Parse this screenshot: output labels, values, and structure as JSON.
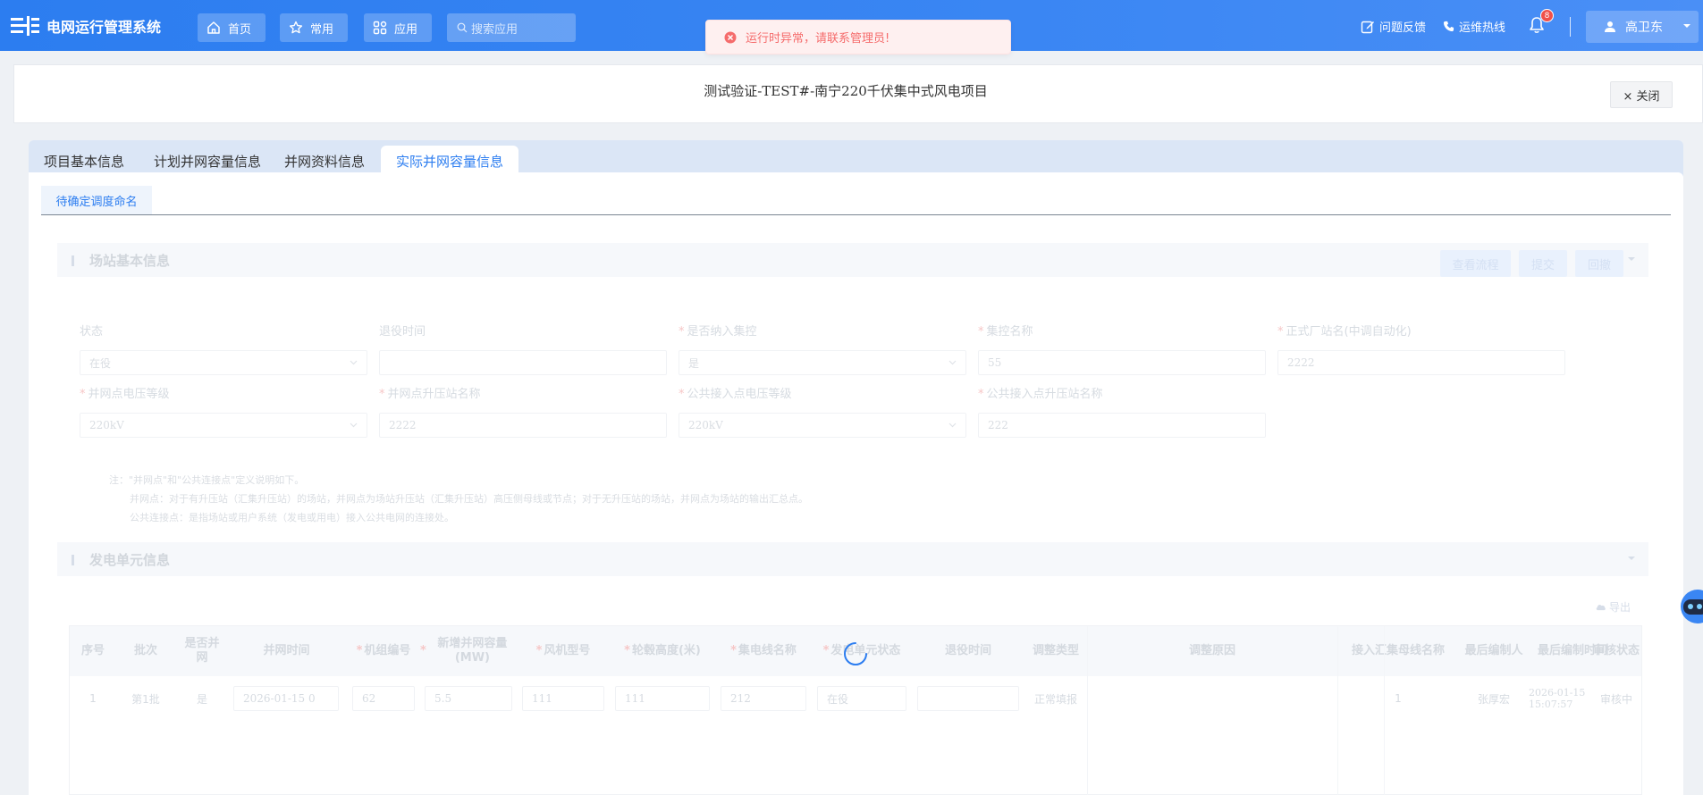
{
  "header": {
    "app_title": "电网运行管理系统",
    "nav": {
      "home": "首页",
      "common": "常用",
      "apps": "应用"
    },
    "search_placeholder": "搜索应用",
    "feedback": "问题反馈",
    "hotline": "运维热线",
    "notification_count": "8",
    "user_name": "高卫东"
  },
  "toast": {
    "message": "运行时异常，请联系管理员!",
    "color": "#f56c6c"
  },
  "page": {
    "title": "测试验证-TEST#-南宁220千伏集中式风电项目",
    "close_label": "× 关闭"
  },
  "tabs": [
    {
      "label": "项目基本信息",
      "active": false
    },
    {
      "label": "计划并网容量信息",
      "active": false
    },
    {
      "label": "并网资料信息",
      "active": false
    },
    {
      "label": "实际并网容量信息",
      "active": true
    }
  ],
  "subtab": {
    "label": "待确定调度命名"
  },
  "station_section": {
    "title": "场站基本信息",
    "buttons": {
      "review_flow": "查看流程",
      "submit": "提交",
      "revoke": "回撤"
    },
    "fields": {
      "status": {
        "label": "状态",
        "value": "在役"
      },
      "retire_time": {
        "label": "退役时间",
        "value": ""
      },
      "is_centralized": {
        "label": "是否纳入集控",
        "value": "是"
      },
      "centralized_name": {
        "label": "集控名称",
        "value": "55"
      },
      "formal_plant_name": {
        "label": "正式厂站名(中调自动化)",
        "value": "2222"
      },
      "grid_voltage": {
        "label": "并网点电压等级",
        "value": "220kV"
      },
      "grid_substation": {
        "label": "并网点升压站名称",
        "value": "2222"
      },
      "pcc_voltage": {
        "label": "公共接入点电压等级",
        "value": "220kV"
      },
      "pcc_substation": {
        "label": "公共接入点升压站名称",
        "value": "222"
      }
    },
    "notes": [
      "注：\"并网点\"和\"公共连接点\"定义说明如下。",
      "并网点：对于有升压站（汇集升压站）的场站，并网点为场站升压站（汇集升压站）高压侧母线或节点；对于无升压站的场站，并网点为场站的输出汇总点。",
      "公共连接点：是指场站或用户系统（发电或用电）接入公共电网的连接处。"
    ]
  },
  "unit_section": {
    "title": "发电单元信息",
    "export_label": "导出",
    "columns": [
      "序号",
      "批次",
      "是否并网",
      "并网时间",
      "机组编号",
      "新增并网容量(MW)",
      "风机型号",
      "轮毂高度(米)",
      "集电线名称",
      "发电单元状态",
      "退役时间",
      "调整类型",
      "调整原因",
      "接入汇集母线名称",
      "最后编制人",
      "最后编制时间",
      "审核状态"
    ],
    "required_columns": [
      "机组编号",
      "新增并网容量(MW)",
      "风机型号",
      "轮毂高度(米)",
      "集电线名称",
      "发电单元状态"
    ],
    "rows": [
      {
        "index": "1",
        "batch": "第1批",
        "is_grid": "是",
        "grid_time": "2026-01-15 0",
        "unit_no": "62",
        "capacity": "5.5",
        "model": "111",
        "hub_height": "111",
        "line_name": "212",
        "status": "在役",
        "retire_time": "",
        "adjust_type": "正常填报",
        "adjust_reason": "",
        "bus_name": "1",
        "editor": "张厚宏",
        "edit_time": "2026-01-15 15:07:57",
        "review_status": "审核中"
      }
    ]
  },
  "colors": {
    "primary": "#2c7df0",
    "error": "#f56c6c",
    "badge": "#f0504a"
  }
}
